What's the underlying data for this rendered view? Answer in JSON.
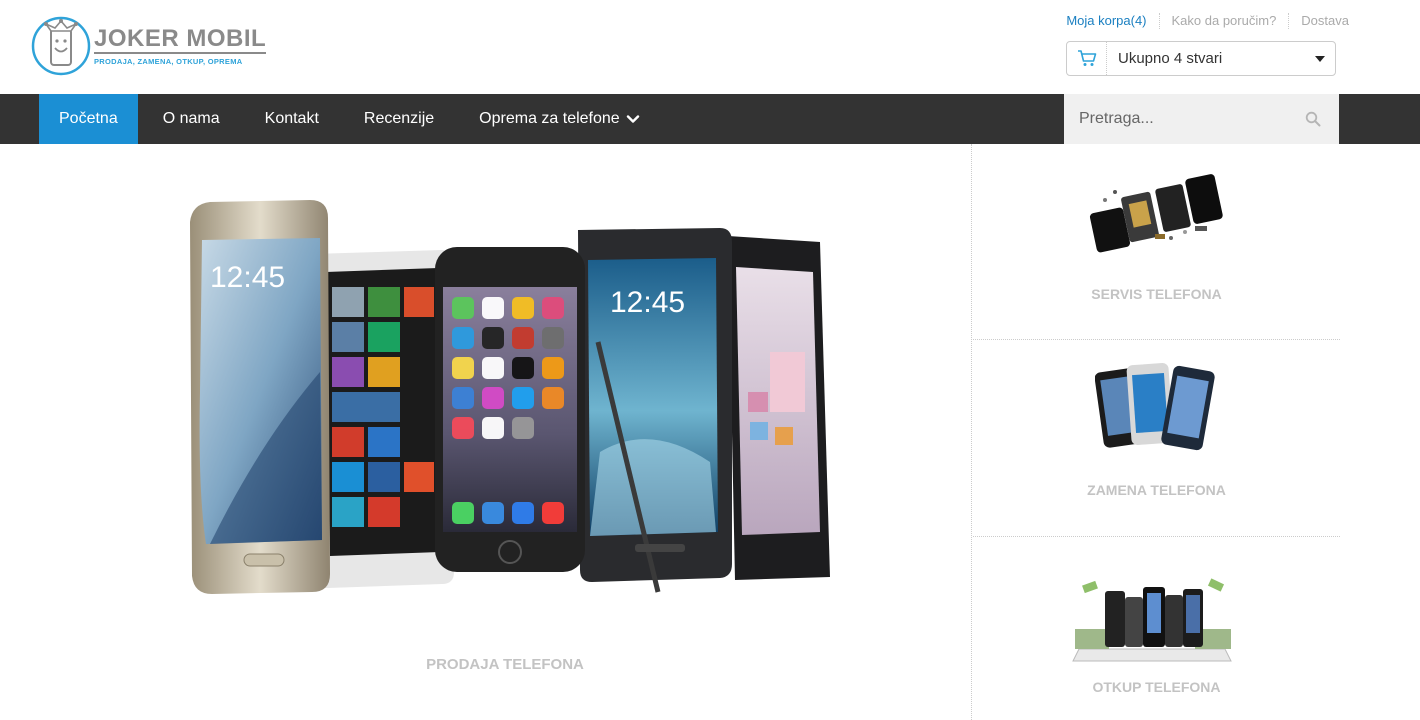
{
  "logo": {
    "name": "JOKER MOBIL",
    "tagline": "PRODAJA, ZAMENA, OTKUP, OPREMA"
  },
  "top_links": [
    "Moja korpa(4)",
    "Kako da poručim?",
    "Dostava"
  ],
  "cart": {
    "label": "Ukupno 4 stvari"
  },
  "nav": {
    "items": [
      "Početna",
      "O nama",
      "Kontakt",
      "Recenzije",
      "Oprema za telefone"
    ],
    "active": "Početna"
  },
  "search": {
    "placeholder": "Pretraga..."
  },
  "main": {
    "hero_caption": "PRODAJA TELEFONA"
  },
  "side": {
    "cards": [
      {
        "caption": "SERVIS TELEFONA"
      },
      {
        "caption": "ZAMENA TELEFONA"
      },
      {
        "caption": "OTKUP TELEFONA"
      }
    ]
  },
  "phone_screens": {
    "clock": "12:45"
  },
  "colors": {
    "accent": "#1b8fd4",
    "nav_bg": "#333333",
    "caption": "#c3c3c3",
    "logo_blue": "#2fa3d9"
  }
}
